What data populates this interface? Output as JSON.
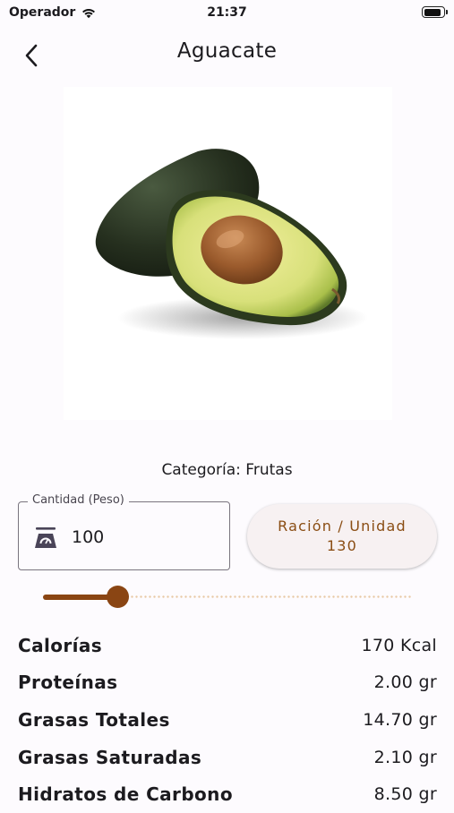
{
  "status": {
    "carrier": "Operador",
    "time": "21:37"
  },
  "header": {
    "title": "Aguacate"
  },
  "category": "Categoría: Frutas",
  "quantity": {
    "label": "Cantidad (Peso)",
    "value": "100"
  },
  "portion": {
    "label": "Ración / Unidad",
    "value": "130"
  },
  "slider": {
    "level": 0.2
  },
  "nutrients": [
    {
      "name": "Calorías",
      "value": "170 Kcal"
    },
    {
      "name": "Proteínas",
      "value": "2.00 gr"
    },
    {
      "name": "Grasas Totales",
      "value": "14.70 gr"
    },
    {
      "name": "Grasas Saturadas",
      "value": "2.10 gr"
    },
    {
      "name": "Hidratos de Carbono",
      "value": "8.50 gr"
    }
  ],
  "colors": {
    "accent": "#8a4513",
    "accent_text": "#8a4d13",
    "background": "#fdfbfe"
  }
}
